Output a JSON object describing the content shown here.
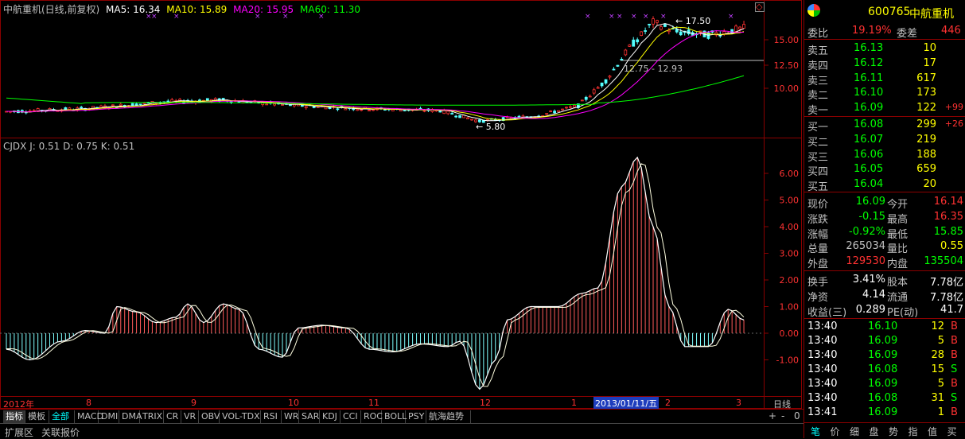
{
  "header": {
    "title": "中航重机(日线,前复权)",
    "ma5": "MA5: 16.34",
    "ma10": "MA10: 15.89",
    "ma20": "MA20: 15.95",
    "ma60": "MA60: 11.30",
    "indicator": "CJDX J: 0.51  D: 0.75  K: 0.51"
  },
  "colors": {
    "up": "#ff3232",
    "down": "#54ffff",
    "ma5": "#ffffff",
    "ma10": "#ffff00",
    "ma20": "#ff00ff",
    "ma60": "#00ff00",
    "grid": "#8b0000"
  },
  "price_axis": [
    "15.00",
    "12.50",
    "10.00"
  ],
  "indicator_axis": [
    "6.00",
    "5.00",
    "4.00",
    "3.00",
    "2.00",
    "1.00",
    "0.00",
    "-1.00"
  ],
  "annotations": {
    "high": "17.50",
    "low": "5.80",
    "range": "12.75 - 12.93"
  },
  "date_axis": {
    "year_label": "2012年",
    "months": [
      "8",
      "9",
      "10",
      "11",
      "12",
      "1",
      "2",
      "3"
    ],
    "selected_date": "2013/01/11/五",
    "period": "日线"
  },
  "zoom_buttons": {
    "plus": "+",
    "minus": "-",
    "zero": "0"
  },
  "tabs": [
    "指标",
    "模板",
    "全部",
    "MACD",
    "DMI",
    "DMA",
    "TRIX",
    "CR",
    "VR",
    "OBV",
    "VOL-TDX",
    "RSI",
    "WR",
    "SAR",
    "KDJ",
    "CCI",
    "ROC",
    "BOLL",
    "PSY",
    "航海趋势"
  ],
  "status_tabs": [
    "扩展区",
    "关联报价"
  ],
  "quote": {
    "code": "600765",
    "name": "中航重机",
    "weibi_label": "委比",
    "weibi_value": "19.19%",
    "weicha_label": "委差",
    "weicha_value": "446",
    "sell": [
      {
        "label": "卖五",
        "price": "16.13",
        "vol": "10",
        "chg": ""
      },
      {
        "label": "卖四",
        "price": "16.12",
        "vol": "17",
        "chg": ""
      },
      {
        "label": "卖三",
        "price": "16.11",
        "vol": "617",
        "chg": ""
      },
      {
        "label": "卖二",
        "price": "16.10",
        "vol": "173",
        "chg": ""
      },
      {
        "label": "卖一",
        "price": "16.09",
        "vol": "122",
        "chg": "+99"
      }
    ],
    "buy": [
      {
        "label": "买一",
        "price": "16.08",
        "vol": "299",
        "chg": "+26"
      },
      {
        "label": "买二",
        "price": "16.07",
        "vol": "219",
        "chg": ""
      },
      {
        "label": "买三",
        "price": "16.06",
        "vol": "188",
        "chg": ""
      },
      {
        "label": "买四",
        "price": "16.05",
        "vol": "659",
        "chg": ""
      },
      {
        "label": "买五",
        "price": "16.04",
        "vol": "20",
        "chg": ""
      }
    ],
    "stats": [
      {
        "l1": "现价",
        "v1": "16.09",
        "l2": "今开",
        "v2": "16.14",
        "c1": "#00ff00",
        "c2": "#ff3232"
      },
      {
        "l1": "涨跌",
        "v1": "-0.15",
        "l2": "最高",
        "v2": "16.35",
        "c1": "#00ff00",
        "c2": "#ff3232"
      },
      {
        "l1": "涨幅",
        "v1": "-0.92%",
        "l2": "最低",
        "v2": "15.85",
        "c1": "#00ff00",
        "c2": "#00ff00"
      },
      {
        "l1": "总量",
        "v1": "265034",
        "l2": "量比",
        "v2": "0.55",
        "c1": "#c0c0c0",
        "c2": "#ffff00"
      },
      {
        "l1": "外盘",
        "v1": "129530",
        "l2": "内盘",
        "v2": "135504",
        "c1": "#ff3232",
        "c2": "#00ff00"
      }
    ],
    "fundamentals": [
      {
        "l1": "换手",
        "v1": "3.41%",
        "l2": "股本",
        "v2": "7.78亿"
      },
      {
        "l1": "净资",
        "v1": "4.14",
        "l2": "流通",
        "v2": "7.78亿"
      },
      {
        "l1": "收益(三)",
        "v1": "0.289",
        "l2": "PE(动)",
        "v2": "41.7"
      }
    ],
    "ticks": [
      {
        "time": "13:40",
        "price": "16.10",
        "vol": "12",
        "side": "B"
      },
      {
        "time": "13:40",
        "price": "16.09",
        "vol": "5",
        "side": "B"
      },
      {
        "time": "13:40",
        "price": "16.09",
        "vol": "28",
        "side": "B"
      },
      {
        "time": "13:40",
        "price": "16.08",
        "vol": "15",
        "side": "S"
      },
      {
        "time": "13:40",
        "price": "16.09",
        "vol": "5",
        "side": "B"
      },
      {
        "time": "13:40",
        "price": "16.08",
        "vol": "31",
        "side": "S"
      },
      {
        "time": "13:41",
        "price": "16.09",
        "vol": "1",
        "side": "B"
      }
    ],
    "bottom_tabs": [
      "笔",
      "价",
      "细",
      "盘",
      "势",
      "指",
      "值",
      "买"
    ]
  }
}
